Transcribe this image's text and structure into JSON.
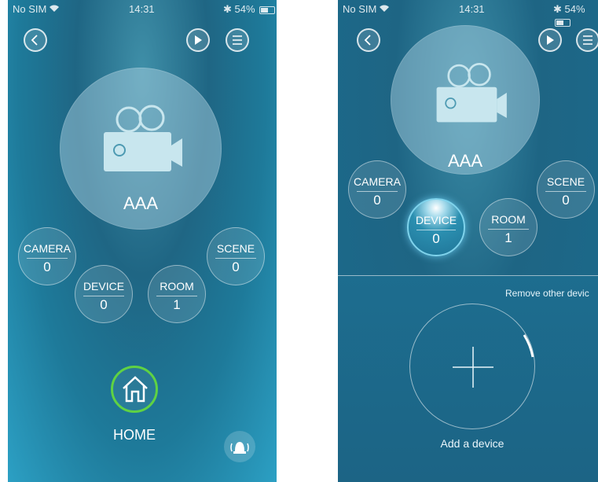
{
  "screens": [
    {
      "status": {
        "carrier": "No SIM",
        "time": "14:31",
        "battery": "54%"
      },
      "header": {
        "back_icon": "chevron-left-icon",
        "play_icon": "play-icon",
        "menu_icon": "menu-icon"
      },
      "main": {
        "name": "AAA",
        "icon": "video-camera-icon"
      },
      "counters": [
        {
          "label": "CAMERA",
          "value": "0"
        },
        {
          "label": "DEVICE",
          "value": "0"
        },
        {
          "label": "ROOM",
          "value": "1"
        },
        {
          "label": "SCENE",
          "value": "0"
        }
      ],
      "home": {
        "label": "HOME",
        "icon": "house-icon"
      },
      "alarm": {
        "icon": "alarm-bell-icon"
      },
      "colors": {
        "home_ring": "#5fd243"
      }
    },
    {
      "status": {
        "carrier": "No SIM",
        "time": "14:31",
        "battery": "54%"
      },
      "header": {
        "back_icon": "chevron-left-icon",
        "play_icon": "play-icon",
        "menu_icon": "menu-icon"
      },
      "main": {
        "name": "AAA",
        "icon": "video-camera-icon"
      },
      "counters": [
        {
          "label": "CAMERA",
          "value": "0"
        },
        {
          "label": "DEVICE",
          "value": "0",
          "active": true
        },
        {
          "label": "ROOM",
          "value": "1"
        },
        {
          "label": "SCENE",
          "value": "0"
        }
      ],
      "panel": {
        "remove_text": "Remove other devic",
        "add_label": "Add a device",
        "add_icon": "plus-icon"
      }
    }
  ]
}
